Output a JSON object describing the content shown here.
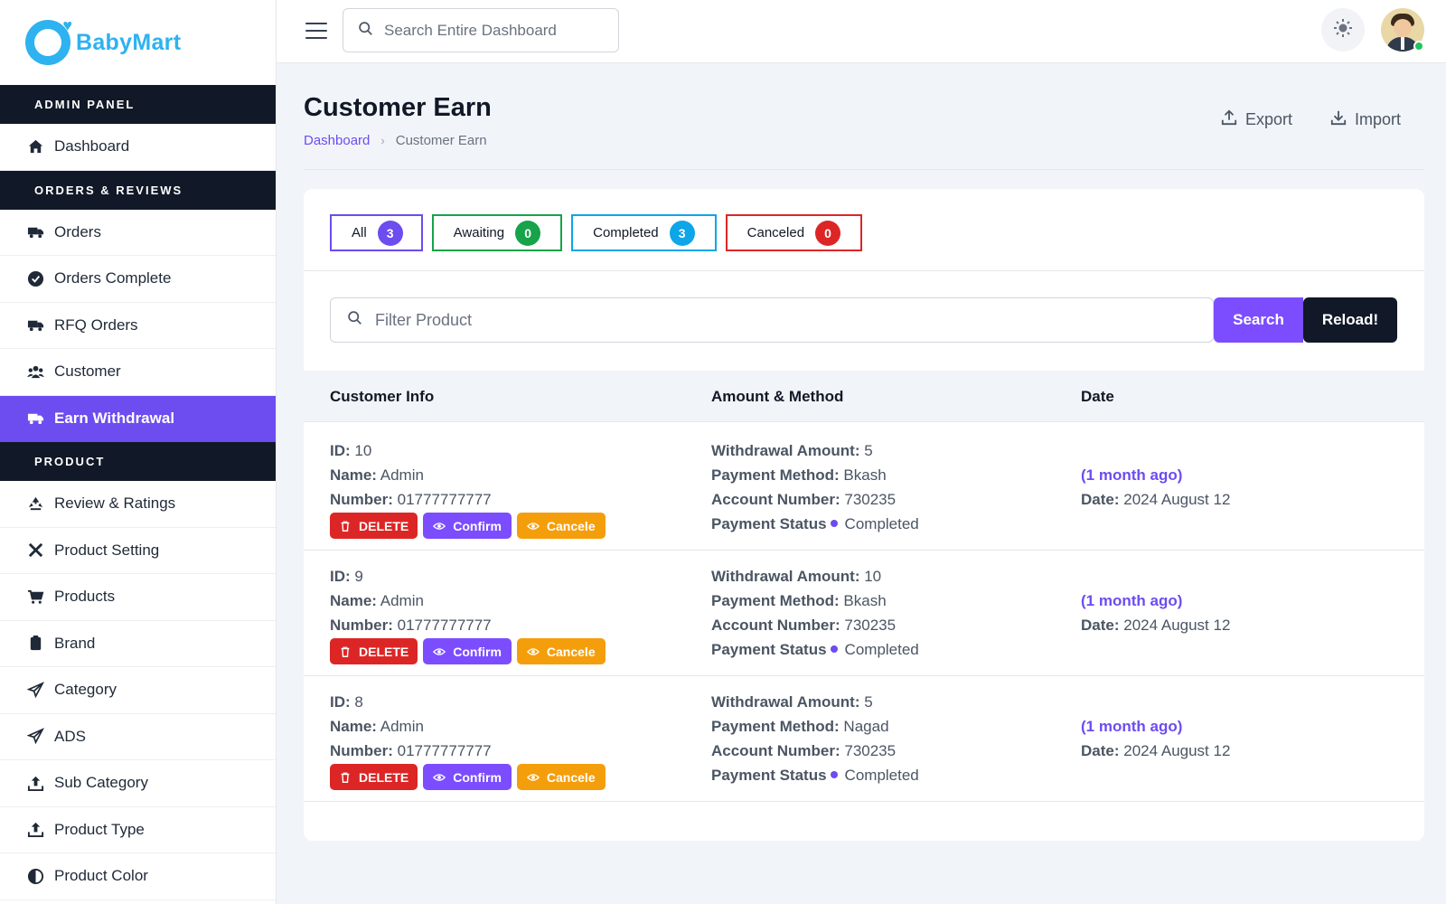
{
  "brand": {
    "name": "BabyMart",
    "color": "#2eb2f0"
  },
  "sidebar": {
    "sections": [
      {
        "heading": "ADMIN PANEL",
        "items": [
          {
            "label": "Dashboard",
            "icon": "dashboard-icon"
          }
        ]
      },
      {
        "heading": "ORDERS & REVIEWS",
        "items": [
          {
            "label": "Orders",
            "icon": "truck-icon"
          },
          {
            "label": "Orders Complete",
            "icon": "check-circle-icon"
          },
          {
            "label": "RFQ Orders",
            "icon": "truck-icon"
          },
          {
            "label": "Customer",
            "icon": "users-icon"
          },
          {
            "label": "Earn Withdrawal",
            "icon": "truck-icon",
            "active": true
          }
        ]
      },
      {
        "heading": "PRODUCT",
        "items": [
          {
            "label": "Review & Ratings",
            "icon": "recycle-icon"
          },
          {
            "label": "Product Setting",
            "icon": "tools-icon"
          },
          {
            "label": "Products",
            "icon": "cart-icon"
          },
          {
            "label": "Brand",
            "icon": "clipboard-icon"
          },
          {
            "label": "Category",
            "icon": "paper-plane-icon"
          },
          {
            "label": "ADS",
            "icon": "paper-plane-icon"
          },
          {
            "label": "Sub Category",
            "icon": "upload-icon"
          },
          {
            "label": "Product Type",
            "icon": "upload-icon"
          },
          {
            "label": "Product Color",
            "icon": "half-circle-icon"
          }
        ]
      }
    ]
  },
  "topbar": {
    "search_placeholder": "Search Entire Dashboard"
  },
  "page": {
    "title": "Customer Earn",
    "breadcrumb": {
      "home": "Dashboard",
      "current": "Customer Earn"
    },
    "actions": {
      "export": "Export",
      "import": "Import"
    }
  },
  "tabs": [
    {
      "label": "All",
      "count": "3",
      "color": "#6d4cf0"
    },
    {
      "label": "Awaiting",
      "count": "0",
      "color": "#16a34a"
    },
    {
      "label": "Completed",
      "count": "3",
      "color": "#0ea5e9"
    },
    {
      "label": "Canceled",
      "count": "0",
      "color": "#dc2626"
    }
  ],
  "filter": {
    "placeholder": "Filter Product",
    "search_label": "Search",
    "reload_label": "Reload!"
  },
  "table": {
    "headers": [
      "Customer Info",
      "Amount & Method",
      "Date"
    ],
    "labels": {
      "id": "ID:",
      "name": "Name:",
      "number": "Number:",
      "amount": "Withdrawal Amount:",
      "method": "Payment Method:",
      "account": "Account Number:",
      "status": "Payment Status",
      "date": "Date:"
    },
    "buttons": {
      "delete": "DELETE",
      "confirm": "Confirm",
      "cancel": "Cancele"
    },
    "rows": [
      {
        "id": "10",
        "name": "Admin",
        "number": "01777777777",
        "amount": "5",
        "method": "Bkash",
        "account": "730235",
        "status": "Completed",
        "ago": "(1 month ago)",
        "date": "2024 August 12"
      },
      {
        "id": "9",
        "name": "Admin",
        "number": "01777777777",
        "amount": "10",
        "method": "Bkash",
        "account": "730235",
        "status": "Completed",
        "ago": "(1 month ago)",
        "date": "2024 August 12"
      },
      {
        "id": "8",
        "name": "Admin",
        "number": "01777777777",
        "amount": "5",
        "method": "Nagad",
        "account": "730235",
        "status": "Completed",
        "ago": "(1 month ago)",
        "date": "2024 August 12"
      }
    ]
  },
  "colors": {
    "accent": "#6d4cf0",
    "dark": "#111827",
    "delete": "#dc2626",
    "cancel": "#f59e0b"
  }
}
